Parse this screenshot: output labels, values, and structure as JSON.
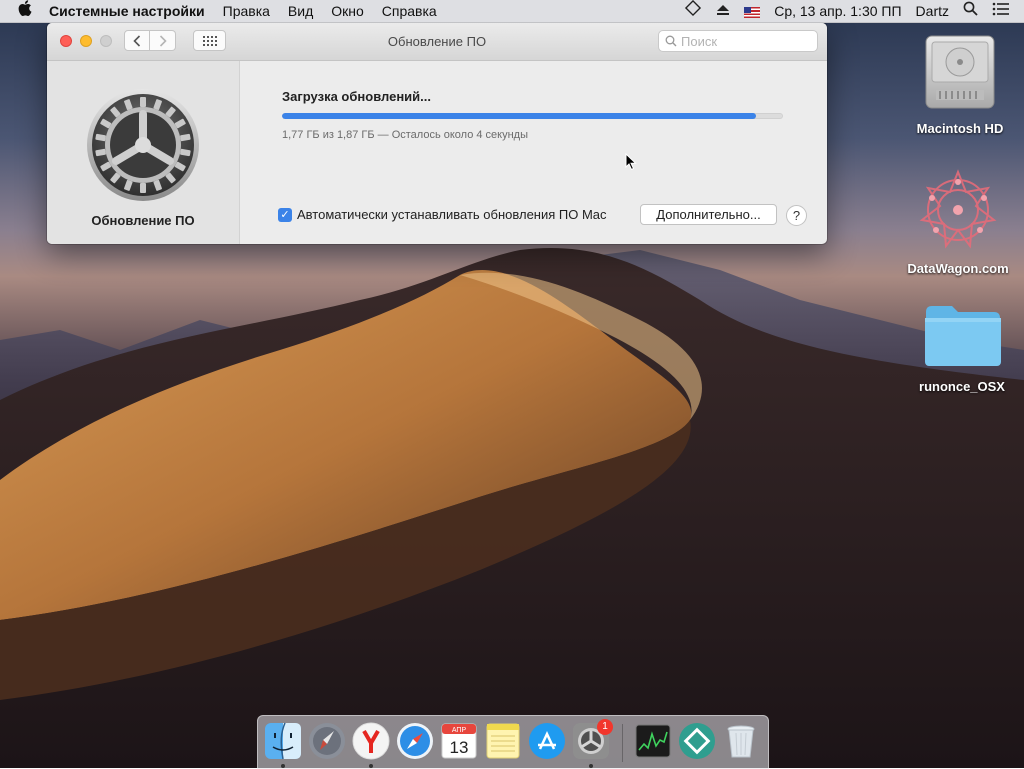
{
  "menubar": {
    "apple": "",
    "app_name": "Системные настройки",
    "menus": [
      "Правка",
      "Вид",
      "Окно",
      "Справка"
    ],
    "datetime": "Ср, 13 апр.  1:30 ПП",
    "user": "Dartz"
  },
  "window": {
    "title": "Обновление ПО",
    "search_placeholder": "Поиск",
    "sidebar_label": "Обновление ПО",
    "status": "Загрузка обновлений...",
    "progress_percent": 94.7,
    "detail": "1,77 ГБ из 1,87 ГБ — Осталось около 4 секунды",
    "auto_update_label": "Автоматически устанавливать обновления ПО Mac",
    "auto_update_checked": true,
    "advanced_button": "Дополнительно...",
    "help_button": "?"
  },
  "desktop": {
    "items": [
      {
        "label": "Macintosh HD",
        "icon": "hard-drive-icon"
      },
      {
        "label": "DataWagon.com",
        "icon": "datawagon-icon"
      },
      {
        "label": "runonce_OSX",
        "icon": "folder-icon"
      }
    ]
  },
  "dock": {
    "items": [
      {
        "name": "Finder",
        "icon": "finder-icon",
        "running": true
      },
      {
        "name": "Launchpad",
        "icon": "launchpad-icon",
        "running": false
      },
      {
        "name": "Yandex",
        "icon": "yandex-browser-icon",
        "running": true
      },
      {
        "name": "Safari",
        "icon": "safari-icon",
        "running": false
      },
      {
        "name": "Calendar",
        "icon": "calendar-icon",
        "running": false,
        "month": "АПР",
        "day": "13"
      },
      {
        "name": "Notes",
        "icon": "notes-icon",
        "running": false
      },
      {
        "name": "App Store",
        "icon": "app-store-icon",
        "running": false
      },
      {
        "name": "System Preferences",
        "icon": "system-preferences-icon",
        "running": true,
        "badge": "1"
      },
      {
        "name": "Activity Monitor",
        "icon": "activity-monitor-icon",
        "running": false
      },
      {
        "name": "App",
        "icon": "teal-app-icon",
        "running": false
      },
      {
        "name": "Trash",
        "icon": "trash-icon",
        "running": false
      }
    ]
  }
}
